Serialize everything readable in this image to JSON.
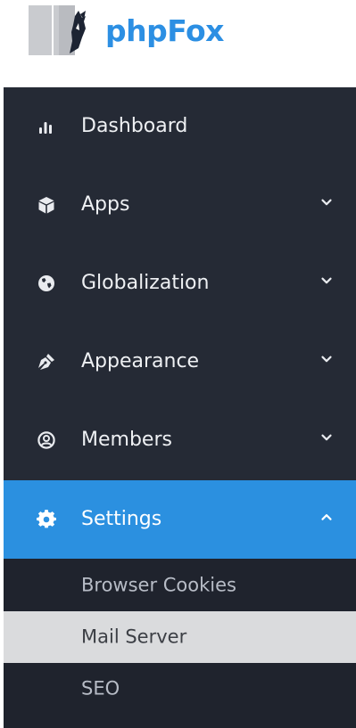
{
  "brand": {
    "name": "phpFox",
    "accent_color": "#2c8fe3"
  },
  "sidebar": {
    "background": "#252a35",
    "items": [
      {
        "label": "Dashboard",
        "icon": "bar-chart-icon",
        "expandable": false
      },
      {
        "label": "Apps",
        "icon": "cube-icon",
        "expandable": true
      },
      {
        "label": "Globalization",
        "icon": "globe-icon",
        "expandable": true
      },
      {
        "label": "Appearance",
        "icon": "pen-nib-icon",
        "expandable": true
      },
      {
        "label": "Members",
        "icon": "user-circle-icon",
        "expandable": true
      },
      {
        "label": "Settings",
        "icon": "gear-icon",
        "expandable": true,
        "expanded": true,
        "active": true
      }
    ],
    "active_color": "#2b90e0",
    "submenu": [
      {
        "label": "Browser Cookies"
      },
      {
        "label": "Mail Server",
        "hovered": true
      },
      {
        "label": "SEO"
      }
    ]
  }
}
